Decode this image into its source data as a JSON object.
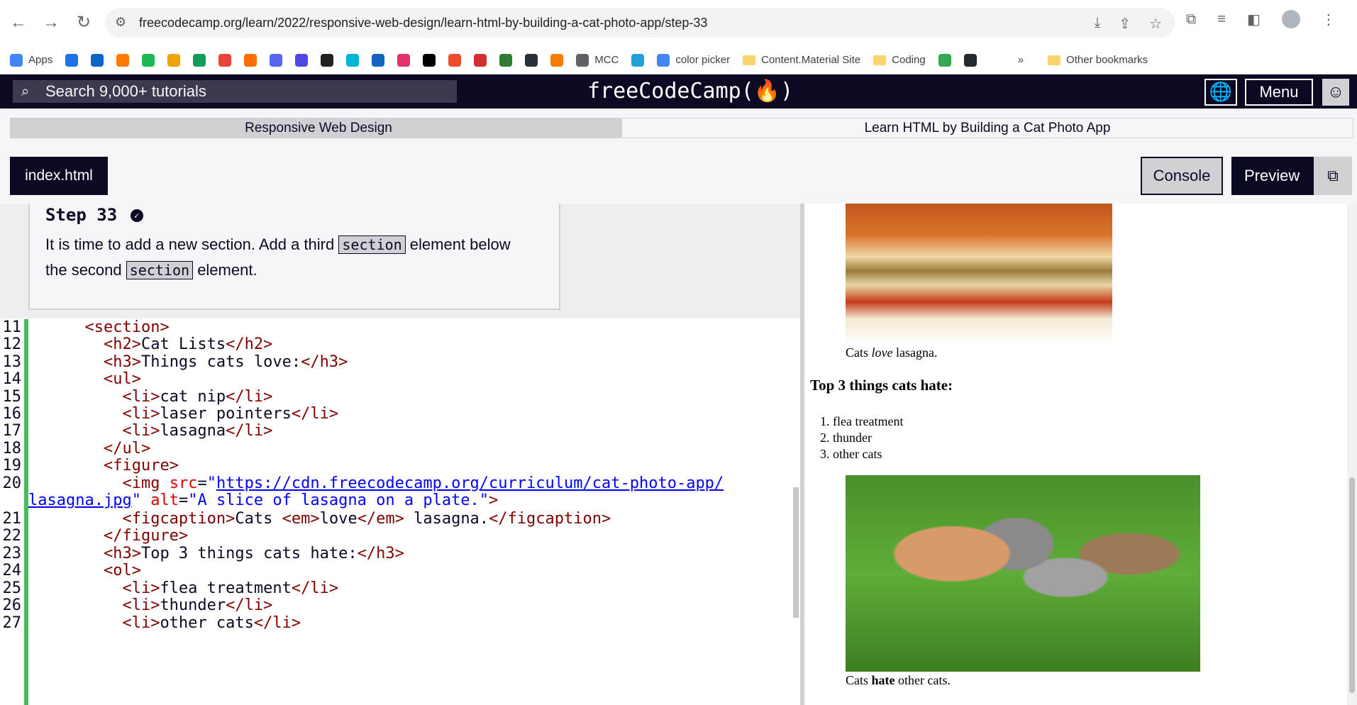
{
  "browser": {
    "url": "freecodecamp.org/learn/2022/responsive-web-design/learn-html-by-building-a-cat-photo-app/step-33",
    "bookmarks": [
      {
        "label": "Apps",
        "color": "#4285f4"
      },
      {
        "label": "",
        "color": "#1a73e8"
      },
      {
        "label": "",
        "color": "#0a66c2"
      },
      {
        "label": "",
        "color": "#ff7a00"
      },
      {
        "label": "",
        "color": "#1db954"
      },
      {
        "label": "",
        "color": "#f0a30a"
      },
      {
        "label": "",
        "color": "#0f9d58"
      },
      {
        "label": "",
        "color": "#ea4335"
      },
      {
        "label": "",
        "color": "#ff6d00"
      },
      {
        "label": "",
        "color": "#5865f2"
      },
      {
        "label": "",
        "color": "#4f46e5"
      },
      {
        "label": "",
        "color": "#202124"
      },
      {
        "label": "",
        "color": "#00b4d8"
      },
      {
        "label": "",
        "color": "#1565c0"
      },
      {
        "label": "",
        "color": "#e1306c"
      },
      {
        "label": "",
        "color": "#000000"
      },
      {
        "label": "",
        "color": "#ee4d2d"
      },
      {
        "label": "",
        "color": "#d32f2f"
      },
      {
        "label": "",
        "color": "#2e7d32"
      },
      {
        "label": "",
        "color": "#263238"
      },
      {
        "label": "",
        "color": "#f57c00"
      },
      {
        "label": "MCC",
        "color": "#5f6368"
      },
      {
        "label": "",
        "color": "#229ed9"
      },
      {
        "label": "color picker",
        "color": "#4285f4"
      },
      {
        "label": "Content.Material Site",
        "color": "#f9d56e"
      },
      {
        "label": "Coding",
        "color": "#f9d56e"
      },
      {
        "label": "",
        "color": "#34a853"
      },
      {
        "label": "",
        "color": "#24292e"
      }
    ],
    "more_bookmarks": "»",
    "other_bookmarks": "Other bookmarks"
  },
  "fcc_nav": {
    "search_placeholder": "Search 9,000+ tutorials",
    "brand": "freeCodeCamp(🔥)",
    "menu_label": "Menu"
  },
  "breadcrumb": {
    "superblock": "Responsive Web Design",
    "block": "Learn HTML by Building a Cat Photo App"
  },
  "tabs": {
    "file": "index.html",
    "console": "Console",
    "preview": "Preview"
  },
  "instructions": {
    "step_title": "Step 33",
    "text_1": "It is time to add a new section. Add a third",
    "code_1": "section",
    "text_2": "element below",
    "text_3": "the second",
    "code_2": "section",
    "text_4": "element."
  },
  "code_lines": [
    {
      "n": "11"
    },
    {
      "n": "12"
    },
    {
      "n": "13"
    },
    {
      "n": "14"
    },
    {
      "n": "15"
    },
    {
      "n": "16"
    },
    {
      "n": "17"
    },
    {
      "n": "18"
    },
    {
      "n": "19"
    },
    {
      "n": "20"
    },
    {
      "n": "21"
    },
    {
      "n": "22"
    },
    {
      "n": "23"
    },
    {
      "n": "24"
    },
    {
      "n": "25"
    },
    {
      "n": "26"
    },
    {
      "n": "27"
    }
  ],
  "preview": {
    "caption1_pre": "Cats ",
    "caption1_em": "love",
    "caption1_post": " lasagna.",
    "h3_hate": "Top 3 things cats hate:",
    "hate_items": [
      "flea treatment",
      "thunder",
      "other cats"
    ],
    "caption2_pre": "Cats ",
    "caption2_strong": "hate",
    "caption2_post": " other cats."
  }
}
